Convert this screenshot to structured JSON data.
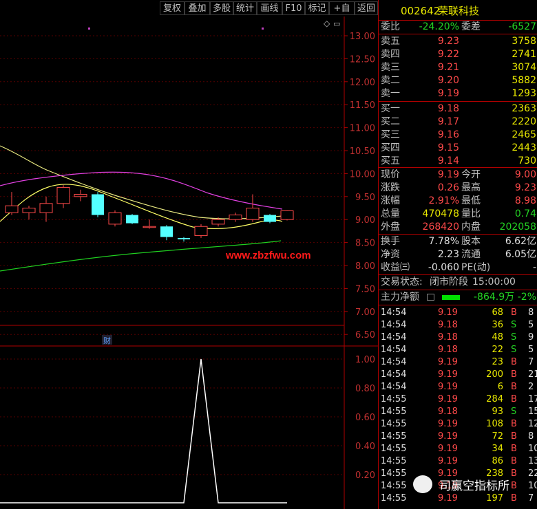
{
  "toolbar": {
    "buttons": [
      "复权",
      "叠加",
      "多股",
      "统计",
      "画线",
      "F10",
      "标记",
      "+自选",
      "返回"
    ]
  },
  "chart": {
    "price_ticks": [
      "13.00",
      "12.50",
      "12.00",
      "11.50",
      "11.00",
      "10.50",
      "10.00",
      "9.50",
      "9.00",
      "8.50",
      "8.00",
      "7.50",
      "7.00",
      "6.50"
    ],
    "indicator_ticks": [
      "1.00",
      "0.80",
      "0.60",
      "0.40",
      "0.20"
    ],
    "watermark": "www.zbzfwu.com",
    "cai_label": "财",
    "diamond_icon": "diamond-icon",
    "bull_color": "#ff4a4a",
    "bear_color": "#54ffff"
  },
  "chart_data": {
    "type": "candlestick",
    "y_range": [
      6.3,
      13.2
    ],
    "candles": [
      {
        "o": 9.15,
        "h": 9.6,
        "l": 9.1,
        "c": 9.3
      },
      {
        "o": 9.15,
        "h": 9.3,
        "l": 9.0,
        "c": 9.25
      },
      {
        "o": 9.15,
        "h": 9.5,
        "l": 8.95,
        "c": 9.35
      },
      {
        "o": 9.35,
        "h": 9.75,
        "l": 9.25,
        "c": 9.7
      },
      {
        "o": 9.5,
        "h": 9.65,
        "l": 9.4,
        "c": 9.55
      },
      {
        "o": 9.55,
        "h": 9.6,
        "l": 9.05,
        "c": 9.1
      },
      {
        "o": 8.9,
        "h": 9.2,
        "l": 8.85,
        "c": 9.15
      },
      {
        "o": 9.1,
        "h": 9.12,
        "l": 8.9,
        "c": 8.92
      },
      {
        "o": 8.85,
        "h": 9.0,
        "l": 8.8,
        "c": 8.85
      },
      {
        "o": 8.85,
        "h": 8.88,
        "l": 8.55,
        "c": 8.62
      },
      {
        "o": 8.6,
        "h": 8.62,
        "l": 8.52,
        "c": 8.57
      },
      {
        "o": 8.65,
        "h": 8.9,
        "l": 8.6,
        "c": 8.85
      },
      {
        "o": 8.9,
        "h": 9.05,
        "l": 8.85,
        "c": 9.0
      },
      {
        "o": 9.0,
        "h": 9.15,
        "l": 8.95,
        "c": 9.1
      },
      {
        "o": 9.0,
        "h": 9.55,
        "l": 8.95,
        "c": 9.25
      },
      {
        "o": 9.1,
        "h": 9.12,
        "l": 8.92,
        "c": 8.95
      },
      {
        "o": 9.0,
        "h": 9.2,
        "l": 8.98,
        "c": 9.19
      }
    ],
    "indicator": [
      0,
      0,
      0,
      0,
      0,
      0,
      0,
      0,
      0,
      0,
      0,
      1,
      0,
      0,
      0,
      0,
      0
    ]
  },
  "panel": {
    "code": "002642",
    "name": "荣联科技",
    "weibi_label": "委比",
    "weibi_value": "-24.20%",
    "weicha_label": "委差",
    "weicha_value": "-6527",
    "asks": [
      {
        "label": "卖五",
        "price": "9.23",
        "vol": "3758"
      },
      {
        "label": "卖四",
        "price": "9.22",
        "vol": "2741"
      },
      {
        "label": "卖三",
        "price": "9.21",
        "vol": "3074"
      },
      {
        "label": "卖二",
        "price": "9.20",
        "vol": "5882"
      },
      {
        "label": "卖一",
        "price": "9.19",
        "vol": "1293"
      }
    ],
    "bids": [
      {
        "label": "买一",
        "price": "9.18",
        "vol": "2363"
      },
      {
        "label": "买二",
        "price": "9.17",
        "vol": "2220"
      },
      {
        "label": "买三",
        "price": "9.16",
        "vol": "2465"
      },
      {
        "label": "买四",
        "price": "9.15",
        "vol": "2443"
      },
      {
        "label": "买五",
        "price": "9.14",
        "vol": "730"
      }
    ],
    "quote": [
      {
        "l1": "现价",
        "v1": "9.19",
        "c1": "red",
        "l2": "今开",
        "v2": "9.00",
        "c2": "red"
      },
      {
        "l1": "涨跌",
        "v1": "0.26",
        "c1": "red",
        "l2": "最高",
        "v2": "9.23",
        "c2": "red"
      },
      {
        "l1": "涨幅",
        "v1": "2.91%",
        "c1": "red",
        "l2": "最低",
        "v2": "8.98",
        "c2": "red"
      },
      {
        "l1": "总量",
        "v1": "470478",
        "c1": "yellow",
        "l2": "量比",
        "v2": "0.74",
        "c2": "green"
      },
      {
        "l1": "外盘",
        "v1": "268420",
        "c1": "red",
        "l2": "内盘",
        "v2": "202058",
        "c2": "green"
      }
    ],
    "stats": [
      {
        "l1": "换手",
        "v1": "7.78%",
        "l2": "股本",
        "v2": "6.62亿"
      },
      {
        "l1": "净资",
        "v1": "2.23",
        "l2": "流通",
        "v2": "6.05亿"
      },
      {
        "l1": "收益㈢",
        "v1": "-0.060",
        "l2": "PE(动)",
        "v2": "-"
      }
    ],
    "status_label": "交易状态:",
    "status_value": "闭市阶段",
    "status_time": "15:00:00",
    "main_net_label": "主力净额",
    "main_net_value": "-864.9万",
    "main_net_pct": "-2%",
    "trades": [
      {
        "t": "14:54",
        "p": "9.19",
        "v": "68",
        "s": "B",
        "n": "8"
      },
      {
        "t": "14:54",
        "p": "9.18",
        "v": "36",
        "s": "S",
        "n": "5"
      },
      {
        "t": "14:54",
        "p": "9.18",
        "v": "48",
        "s": "S",
        "n": "9"
      },
      {
        "t": "14:54",
        "p": "9.18",
        "v": "22",
        "s": "S",
        "n": "5"
      },
      {
        "t": "14:54",
        "p": "9.19",
        "v": "23",
        "s": "B",
        "n": "7"
      },
      {
        "t": "14:54",
        "p": "9.19",
        "v": "200",
        "s": "B",
        "n": "21"
      },
      {
        "t": "14:54",
        "p": "9.19",
        "v": "6",
        "s": "B",
        "n": "2"
      },
      {
        "t": "14:55",
        "p": "9.19",
        "v": "284",
        "s": "B",
        "n": "17"
      },
      {
        "t": "14:55",
        "p": "9.18",
        "v": "93",
        "s": "S",
        "n": "15"
      },
      {
        "t": "14:55",
        "p": "9.19",
        "v": "108",
        "s": "B",
        "n": "12"
      },
      {
        "t": "14:55",
        "p": "9.19",
        "v": "72",
        "s": "B",
        "n": "8"
      },
      {
        "t": "14:55",
        "p": "9.19",
        "v": "34",
        "s": "B",
        "n": "10"
      },
      {
        "t": "14:55",
        "p": "9.19",
        "v": "86",
        "s": "B",
        "n": "13"
      },
      {
        "t": "14:55",
        "p": "9.19",
        "v": "238",
        "s": "B",
        "n": "22"
      },
      {
        "t": "14:55",
        "p": "9.19",
        "v": "",
        "s": "B",
        "n": "10"
      },
      {
        "t": "14:55",
        "p": "9.19",
        "v": "197",
        "s": "B",
        "n": "7"
      }
    ],
    "brand": "司赢空指标所"
  }
}
